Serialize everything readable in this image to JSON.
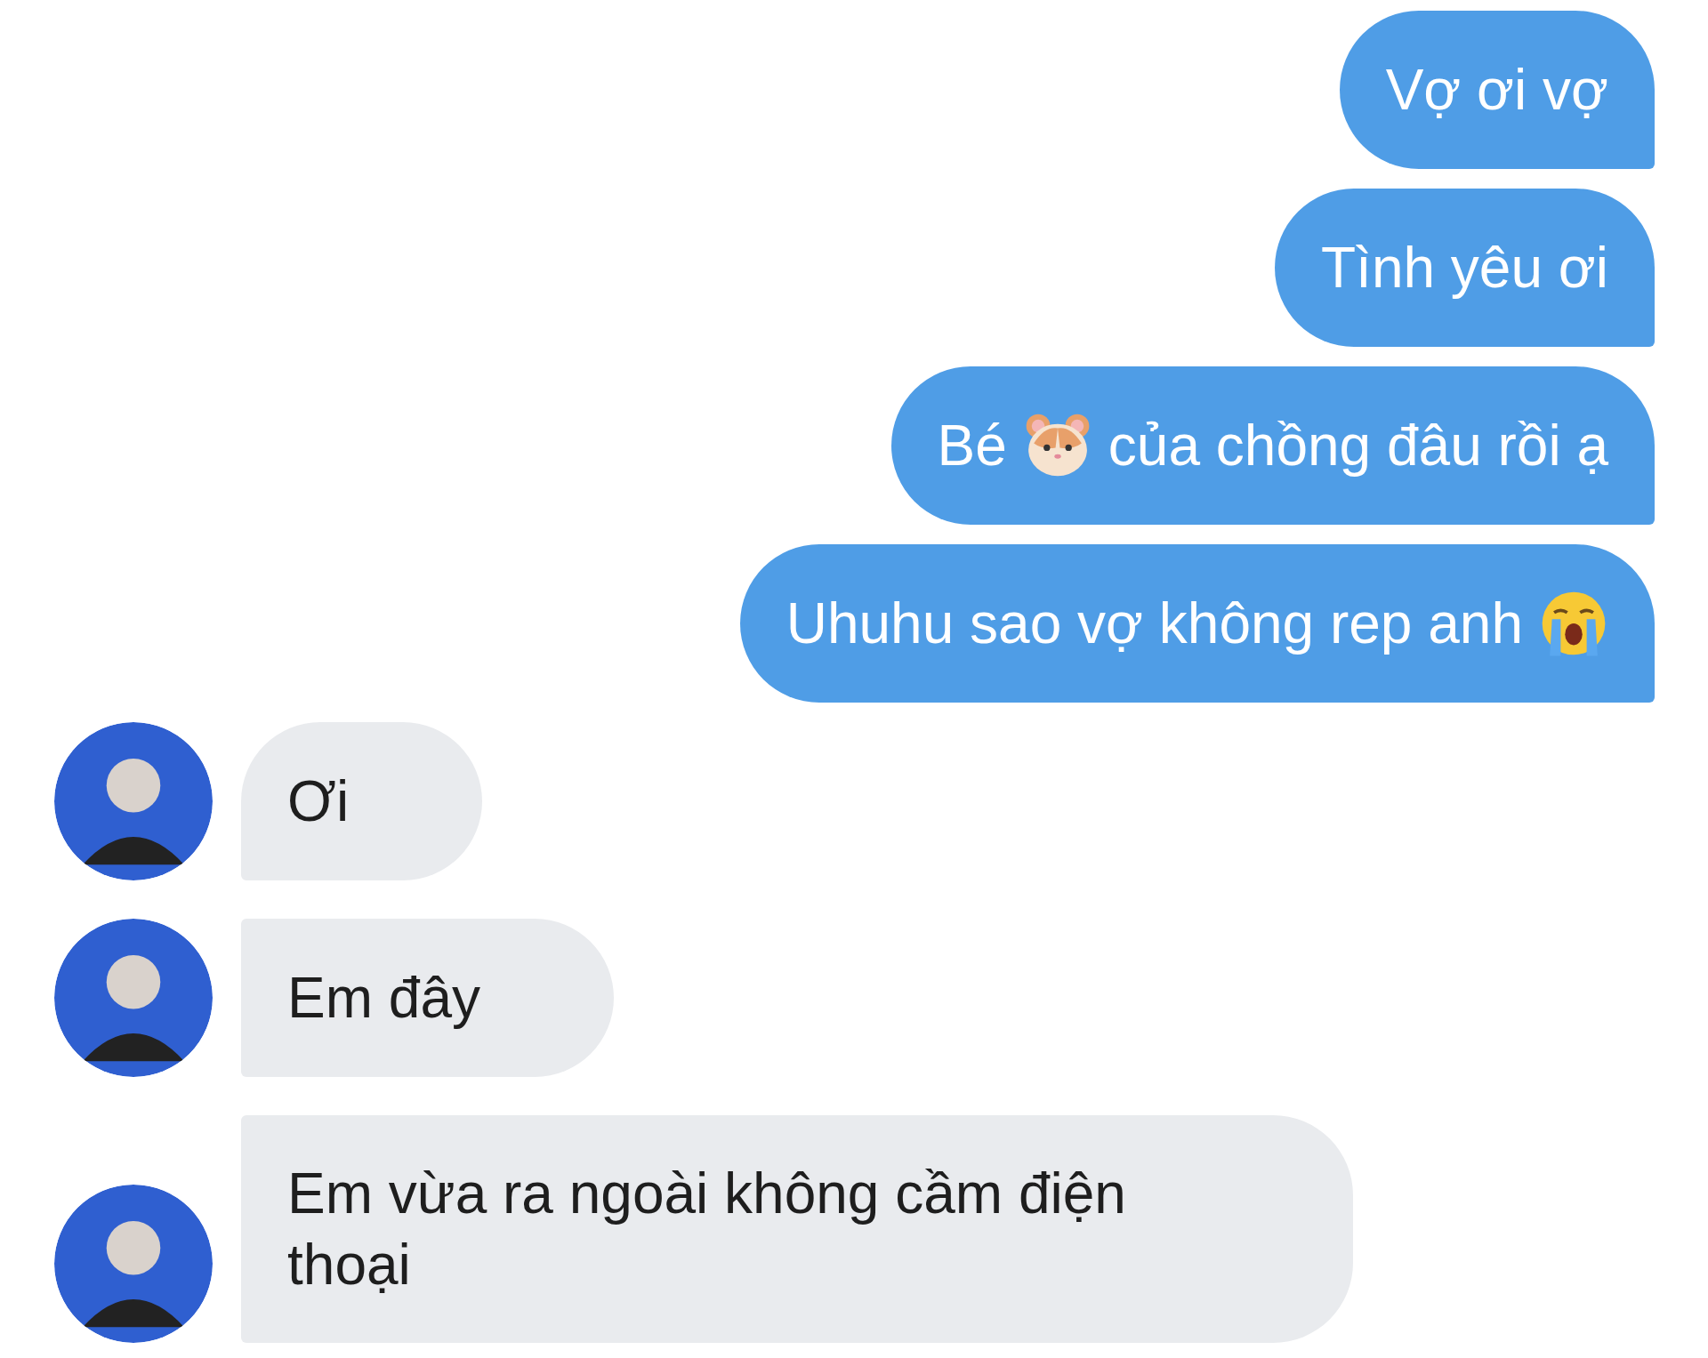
{
  "messages": [
    {
      "outgoing": true,
      "segments": [
        {
          "kind": "text",
          "text": "Vợ ơi vợ"
        }
      ]
    },
    {
      "outgoing": true,
      "segments": [
        {
          "kind": "text",
          "text": "Tình yêu ơi"
        }
      ]
    },
    {
      "outgoing": true,
      "segments": [
        {
          "kind": "text",
          "text": "Bé"
        },
        {
          "kind": "hamster"
        },
        {
          "kind": "text",
          "text": "của chồng đâu rồi ạ"
        }
      ]
    },
    {
      "outgoing": true,
      "segments": [
        {
          "kind": "text",
          "text": "Uhuhu sao vợ không rep anh"
        },
        {
          "kind": "crying"
        }
      ]
    },
    {
      "outgoing": false,
      "segments": [
        {
          "kind": "text",
          "text": "Ơi"
        }
      ]
    },
    {
      "outgoing": false,
      "segments": [
        {
          "kind": "text",
          "text": "Em đây"
        }
      ]
    },
    {
      "outgoing": false,
      "segments": [
        {
          "kind": "text",
          "text": "Em vừa ra ngoài không cầm điện thoại"
        }
      ]
    }
  ]
}
